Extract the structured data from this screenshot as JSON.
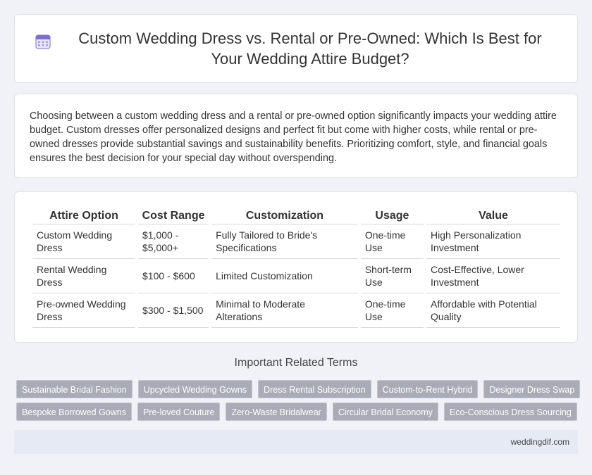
{
  "header": {
    "title": "Custom Wedding Dress vs. Rental or Pre-Owned: Which Is Best for Your Wedding Attire Budget?",
    "icon": "calendar-icon"
  },
  "intro": {
    "text": "Choosing between a custom wedding dress and a rental or pre-owned option significantly impacts your wedding attire budget. Custom dresses offer personalized designs and perfect fit but come with higher costs, while rental or pre-owned dresses provide substantial savings and sustainability benefits. Prioritizing comfort, style, and financial goals ensures the best decision for your special day without overspending."
  },
  "table": {
    "headers": [
      "Attire Option",
      "Cost Range",
      "Customization",
      "Usage",
      "Value"
    ],
    "rows": [
      [
        "Custom Wedding Dress",
        "$1,000 - $5,000+",
        "Fully Tailored to Bride's Specifications",
        "One-time Use",
        "High Personalization Investment"
      ],
      [
        "Rental Wedding Dress",
        "$100 - $600",
        "Limited Customization",
        "Short-term Use",
        "Cost-Effective, Lower Investment"
      ],
      [
        "Pre-owned Wedding Dress",
        "$300 - $1,500",
        "Minimal to Moderate Alterations",
        "One-time Use",
        "Affordable with Potential Quality"
      ]
    ]
  },
  "related": {
    "heading": "Important Related Terms",
    "row1": [
      "Sustainable Bridal Fashion",
      "Upcycled Wedding Gowns",
      "Dress Rental Subscription",
      "Custom-to-Rent Hybrid",
      "Designer Dress Swap"
    ],
    "row2": [
      "Bespoke Borrowed Gowns",
      "Pre-loved Couture",
      "Zero-Waste Bridalwear",
      "Circular Bridal Economy",
      "Eco-Conscious Dress Sourcing"
    ]
  },
  "footer": {
    "site": "weddingdif.com"
  },
  "colors": {
    "page_bg": "#f0f2f8",
    "tag_bg": "#a9acb6",
    "footer_bg": "#e6eaf4",
    "icon_accent": "#7b6fd6"
  }
}
